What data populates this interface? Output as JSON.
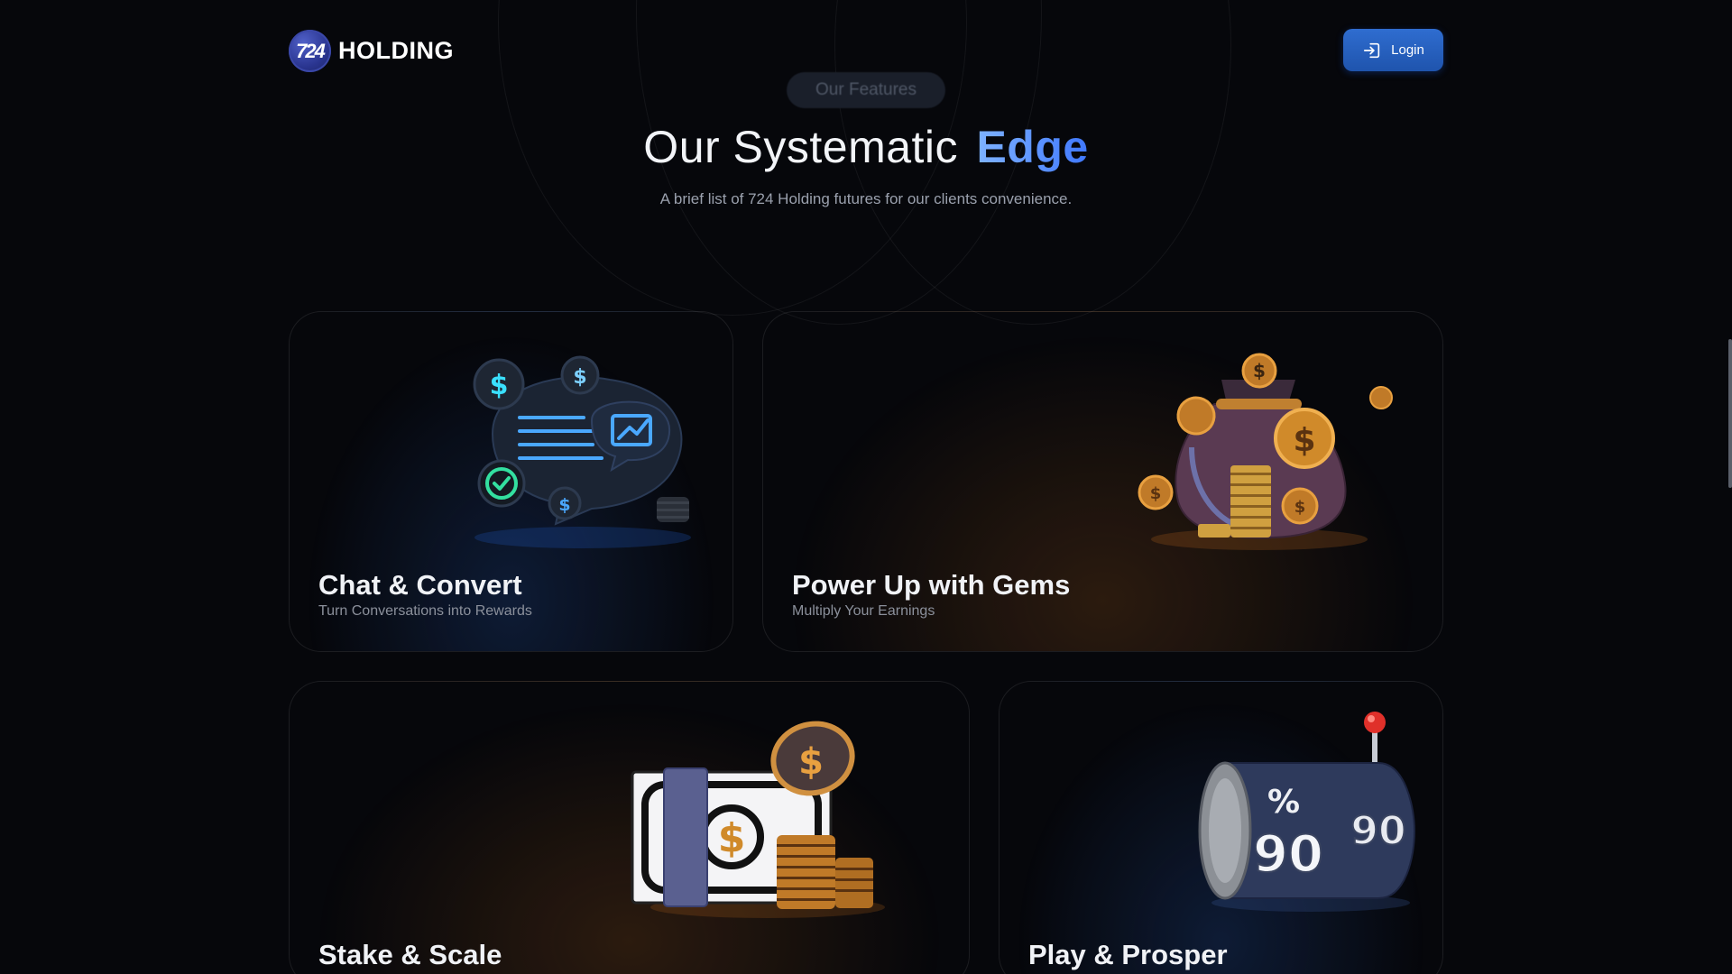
{
  "header": {
    "logo_text": "724",
    "brand_name": "HOLDING",
    "login_label": "Login"
  },
  "features": {
    "pill_label": "Our Features",
    "title_main": "Our Systematic",
    "title_accent": "Edge",
    "subtitle": "A brief list of 724 Holding futures for our clients convenience."
  },
  "cards": [
    {
      "title": "Chat & Convert",
      "subtitle": "Turn Conversations into Rewards",
      "icon": "chat-money-icon"
    },
    {
      "title": "Power Up with Gems",
      "subtitle": "Multiply Your Earnings",
      "icon": "money-bag-icon"
    },
    {
      "title": "Stake & Scale",
      "subtitle": "",
      "icon": "banknote-coins-icon"
    },
    {
      "title": "Play & Prosper",
      "subtitle": "",
      "icon": "slot-machine-icon"
    }
  ],
  "colors": {
    "background": "#06070b",
    "accent_blue": "#3f78ff",
    "login_button": "#2a63c4"
  },
  "art_labels": {
    "slot_percent": "%",
    "slot_value_a": "90",
    "slot_value_b": "90",
    "dollar": "$"
  }
}
